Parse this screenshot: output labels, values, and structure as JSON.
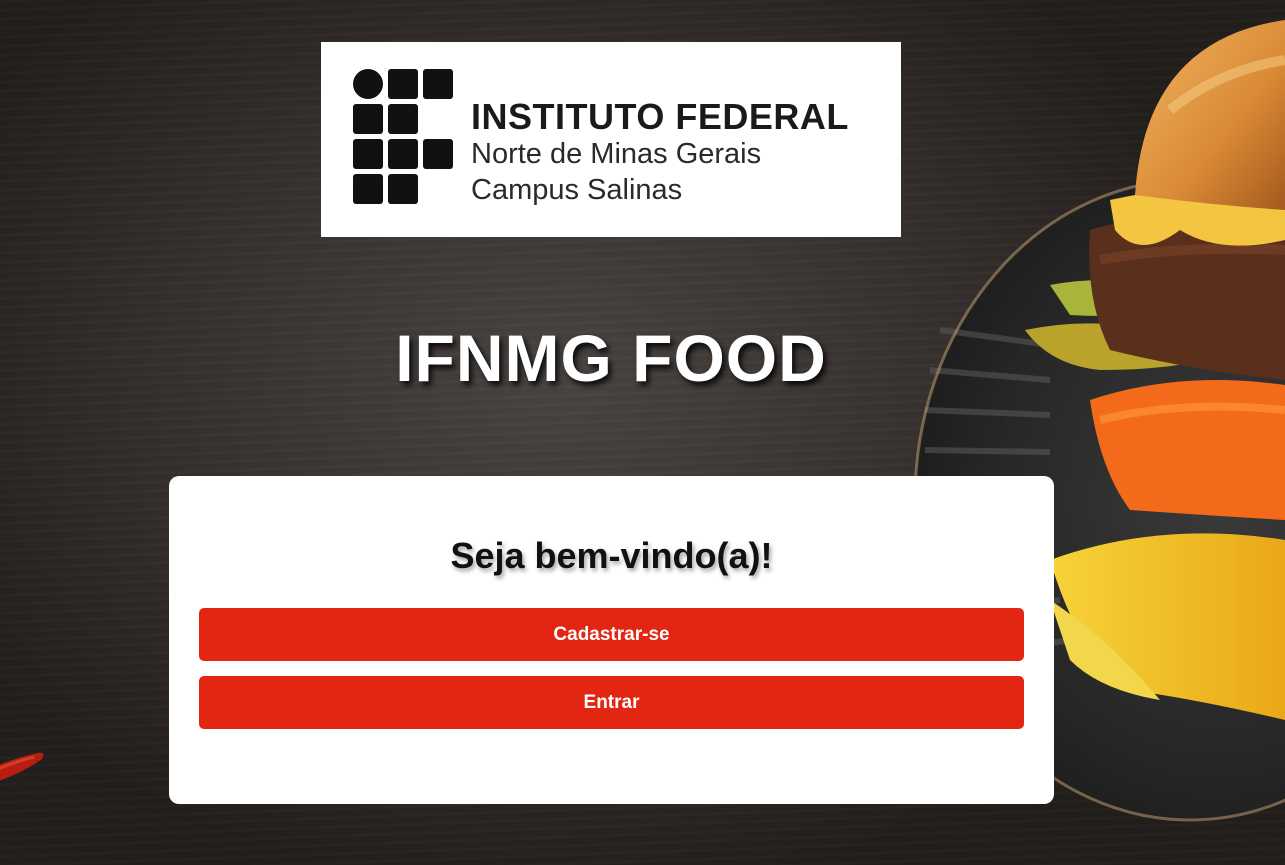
{
  "logo": {
    "title": "INSTITUTO FEDERAL",
    "line1": "Norte de Minas Gerais",
    "line2": "Campus Salinas"
  },
  "app": {
    "title": "IFNMG FOOD"
  },
  "card": {
    "welcome": "Seja bem-vindo(a)!",
    "register_label": "Cadastrar-se",
    "login_label": "Entrar"
  },
  "colors": {
    "accent": "#e32612",
    "card_bg": "#ffffff",
    "background": "#3a3431"
  },
  "icons": {
    "logo_mark": "ifnmg-logo-grid-icon",
    "background_art": "burger-photo",
    "pepper_art": "red-pepper"
  }
}
